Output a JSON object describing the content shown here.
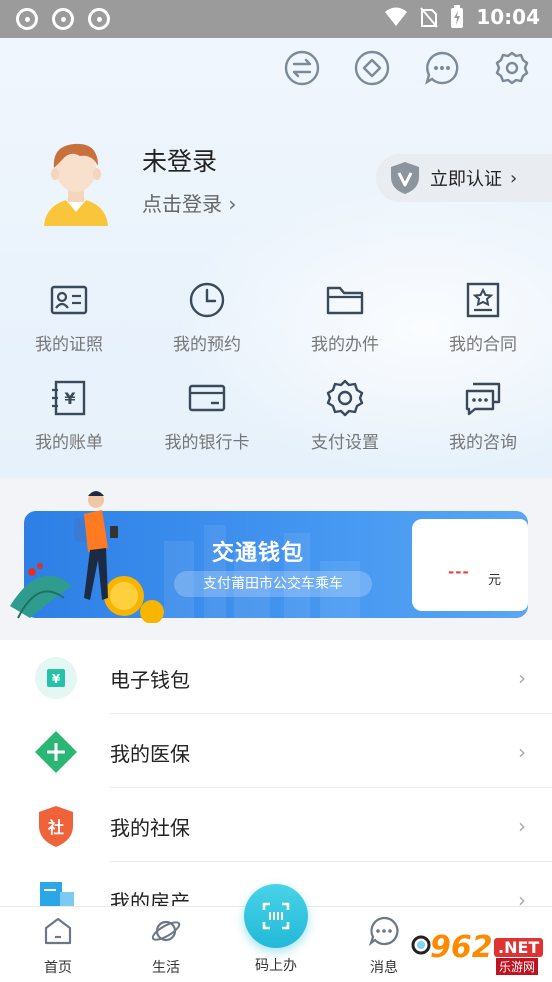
{
  "status_bar": {
    "time": "10:04"
  },
  "header": {
    "top_icons": [
      "switch-icon",
      "diamond-icon",
      "message-icon",
      "settings-icon"
    ],
    "user": {
      "title": "未登录",
      "subtitle": "点击登录 ›"
    },
    "verify": {
      "label": "立即认证",
      "chevron": "›"
    }
  },
  "grid": [
    {
      "label": "我的证照",
      "icon": "id-card-icon"
    },
    {
      "label": "我的预约",
      "icon": "clock-icon"
    },
    {
      "label": "我的办件",
      "icon": "folder-icon"
    },
    {
      "label": "我的合同",
      "icon": "contract-icon"
    },
    {
      "label": "我的账单",
      "icon": "bill-icon"
    },
    {
      "label": "我的银行卡",
      "icon": "bank-card-icon"
    },
    {
      "label": "支付设置",
      "icon": "gear-icon"
    },
    {
      "label": "我的咨询",
      "icon": "chat-icon"
    }
  ],
  "banner": {
    "title": "交通钱包",
    "subtitle": "支付莆田市公交车乘车",
    "value": "---",
    "unit": "元"
  },
  "list": [
    {
      "label": "电子钱包",
      "icon": "wallet-icon",
      "color": "#27c0a8"
    },
    {
      "label": "我的医保",
      "icon": "medical-icon",
      "color": "#2bb673"
    },
    {
      "label": "我的社保",
      "icon": "social-security-icon",
      "color": "#f0623a"
    },
    {
      "label": "我的房产",
      "icon": "property-icon",
      "color": "#2ba7e8"
    }
  ],
  "tabbar": {
    "tabs": [
      {
        "label": "首页"
      },
      {
        "label": "生活"
      },
      {
        "label": "码上办"
      },
      {
        "label": "消息"
      }
    ]
  },
  "watermark": {
    "big": "962",
    "net": ".NET",
    "small": "乐游网"
  },
  "colors": {
    "accent": "#22b9d8",
    "banner_blue": "#2d7fe6",
    "value_red": "#e8423b"
  }
}
